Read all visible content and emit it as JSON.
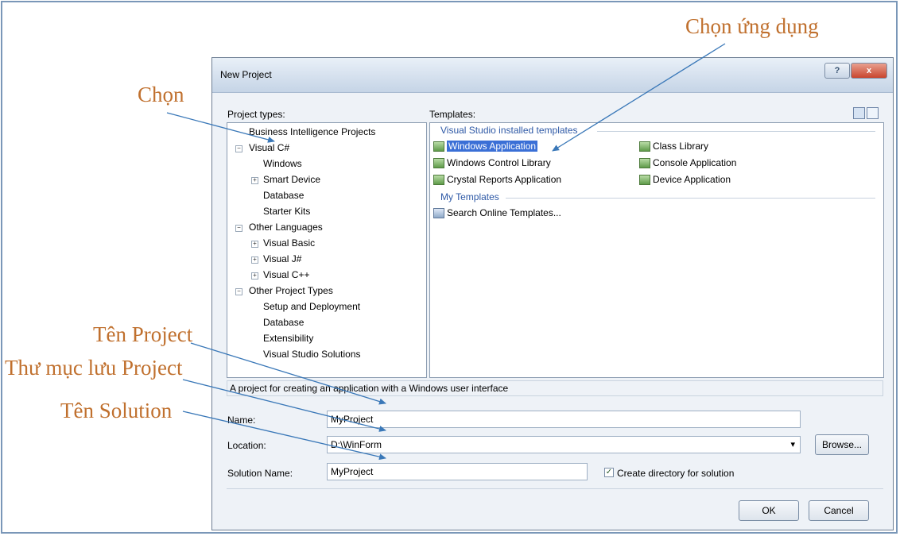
{
  "callouts": {
    "choose": "Chọn",
    "choose_app": "Chọn ứng dụng",
    "project_name": "Tên Project",
    "save_folder": "Thư mục lưu Project",
    "solution_name": "Tên Solution"
  },
  "dialog": {
    "title": "New Project",
    "help_glyph": "?",
    "close_glyph": "x",
    "project_types_label": "Project types:",
    "templates_label": "Templates:",
    "project_types": [
      "Business Intelligence Projects",
      "Visual C#",
      "Windows",
      "Smart Device",
      "Database",
      "Starter Kits",
      "Other Languages",
      "Visual Basic",
      "Visual J#",
      "Visual C++",
      "Other Project Types",
      "Setup and Deployment",
      "Database",
      "Extensibility",
      "Visual Studio Solutions"
    ],
    "template_groups": {
      "installed": "Visual Studio installed templates",
      "my": "My Templates"
    },
    "templates": [
      "Windows Application",
      "Class Library",
      "Windows Control Library",
      "Console Application",
      "Crystal Reports Application",
      "Device Application",
      "Search Online Templates..."
    ],
    "selected_template": "Windows Application",
    "description": "A project for creating an application with a Windows user interface",
    "name_label": "Name:",
    "name_value": "MyProject",
    "location_label": "Location:",
    "location_value": "D:\\WinForm",
    "dropdown_glyph": "▾",
    "solution_label": "Solution Name:",
    "solution_value": "MyProject",
    "create_dir_label": "Create directory for solution",
    "create_dir_checked": true,
    "browse_label": "Browse...",
    "ok_label": "OK",
    "cancel_label": "Cancel"
  },
  "colors": {
    "callout": "#c0702e",
    "arrow": "#3a78b8",
    "selection": "#3a6fd6",
    "group_header": "#2e59a6"
  }
}
